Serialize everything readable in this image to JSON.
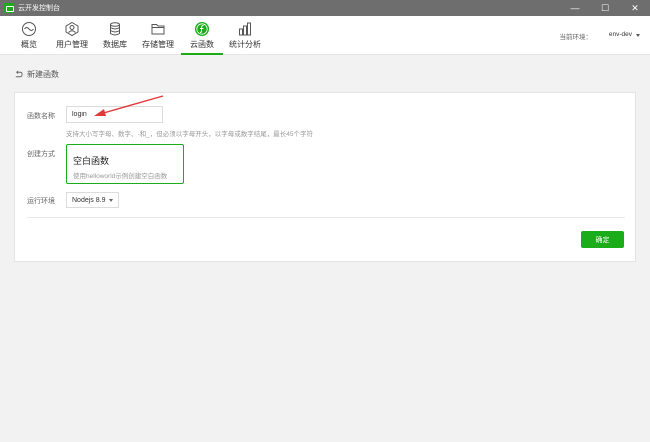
{
  "window": {
    "title": "云开发控制台",
    "controls": [
      "—",
      "☐",
      "✕"
    ]
  },
  "nav": {
    "items": [
      {
        "label": "概览",
        "icon": "overview-icon"
      },
      {
        "label": "用户管理",
        "icon": "user-management-icon"
      },
      {
        "label": "数据库",
        "icon": "database-icon"
      },
      {
        "label": "存储管理",
        "icon": "folder-icon"
      },
      {
        "label": "云函数",
        "icon": "cloud-function-icon",
        "active": true
      },
      {
        "label": "统计分析",
        "icon": "statistics-icon"
      }
    ],
    "env_label": "当前环境：",
    "env_value": "env-dev"
  },
  "page": {
    "title": "新建函数"
  },
  "form": {
    "name_label": "函数名称",
    "name_value": "login",
    "name_hint": "支持大小写字母、数字、-和_，但必须以字母开头，以字母或数字结尾，最长45个字符",
    "method_label": "创建方式",
    "method_title": "空白函数",
    "method_desc": "使用helloworld示例创建空白函数",
    "runtime_label": "运行环境",
    "runtime_value": "Nodejs 8.9",
    "confirm_label": "确定"
  },
  "colors": {
    "accent": "#1aad19",
    "titlebar": "#6e6e6e",
    "annotation_arrow": "#e23a3a"
  }
}
